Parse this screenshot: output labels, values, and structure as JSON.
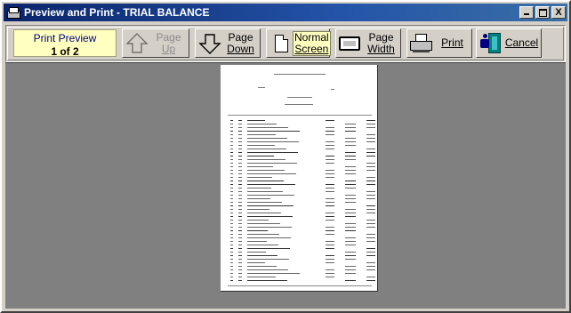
{
  "window": {
    "title": "Preview and Print - TRIAL BALANCE",
    "controls": {
      "minimize": "_",
      "maximize": "□",
      "close": "X"
    }
  },
  "toolbar": {
    "counter_label": "Print Preview",
    "counter_value": "1 of 2",
    "buttons": [
      {
        "id": "page-up",
        "line1": "Page",
        "line2": "Up",
        "enabled": false,
        "icon": "up-arrow-icon"
      },
      {
        "id": "page-down",
        "line1": "Page",
        "line2": "Down",
        "enabled": true,
        "icon": "down-arrow-icon"
      },
      {
        "id": "normal-screen",
        "line1": "Normal",
        "line2": "Screen",
        "enabled": true,
        "icon": "page-icon"
      },
      {
        "id": "page-width",
        "line1": "Page",
        "line2": "Width",
        "enabled": true,
        "icon": "monitor-icon"
      },
      {
        "id": "print",
        "line1": "Print",
        "enabled": true,
        "icon": "printer-icon"
      },
      {
        "id": "cancel",
        "line1": "Cancel",
        "enabled": true,
        "icon": "exit-door-icon"
      }
    ]
  },
  "colors": {
    "titlebar": "#0a246a",
    "face": "#d4d0c8",
    "viewport": "#808080",
    "counter_bg": "#ffffc0"
  }
}
